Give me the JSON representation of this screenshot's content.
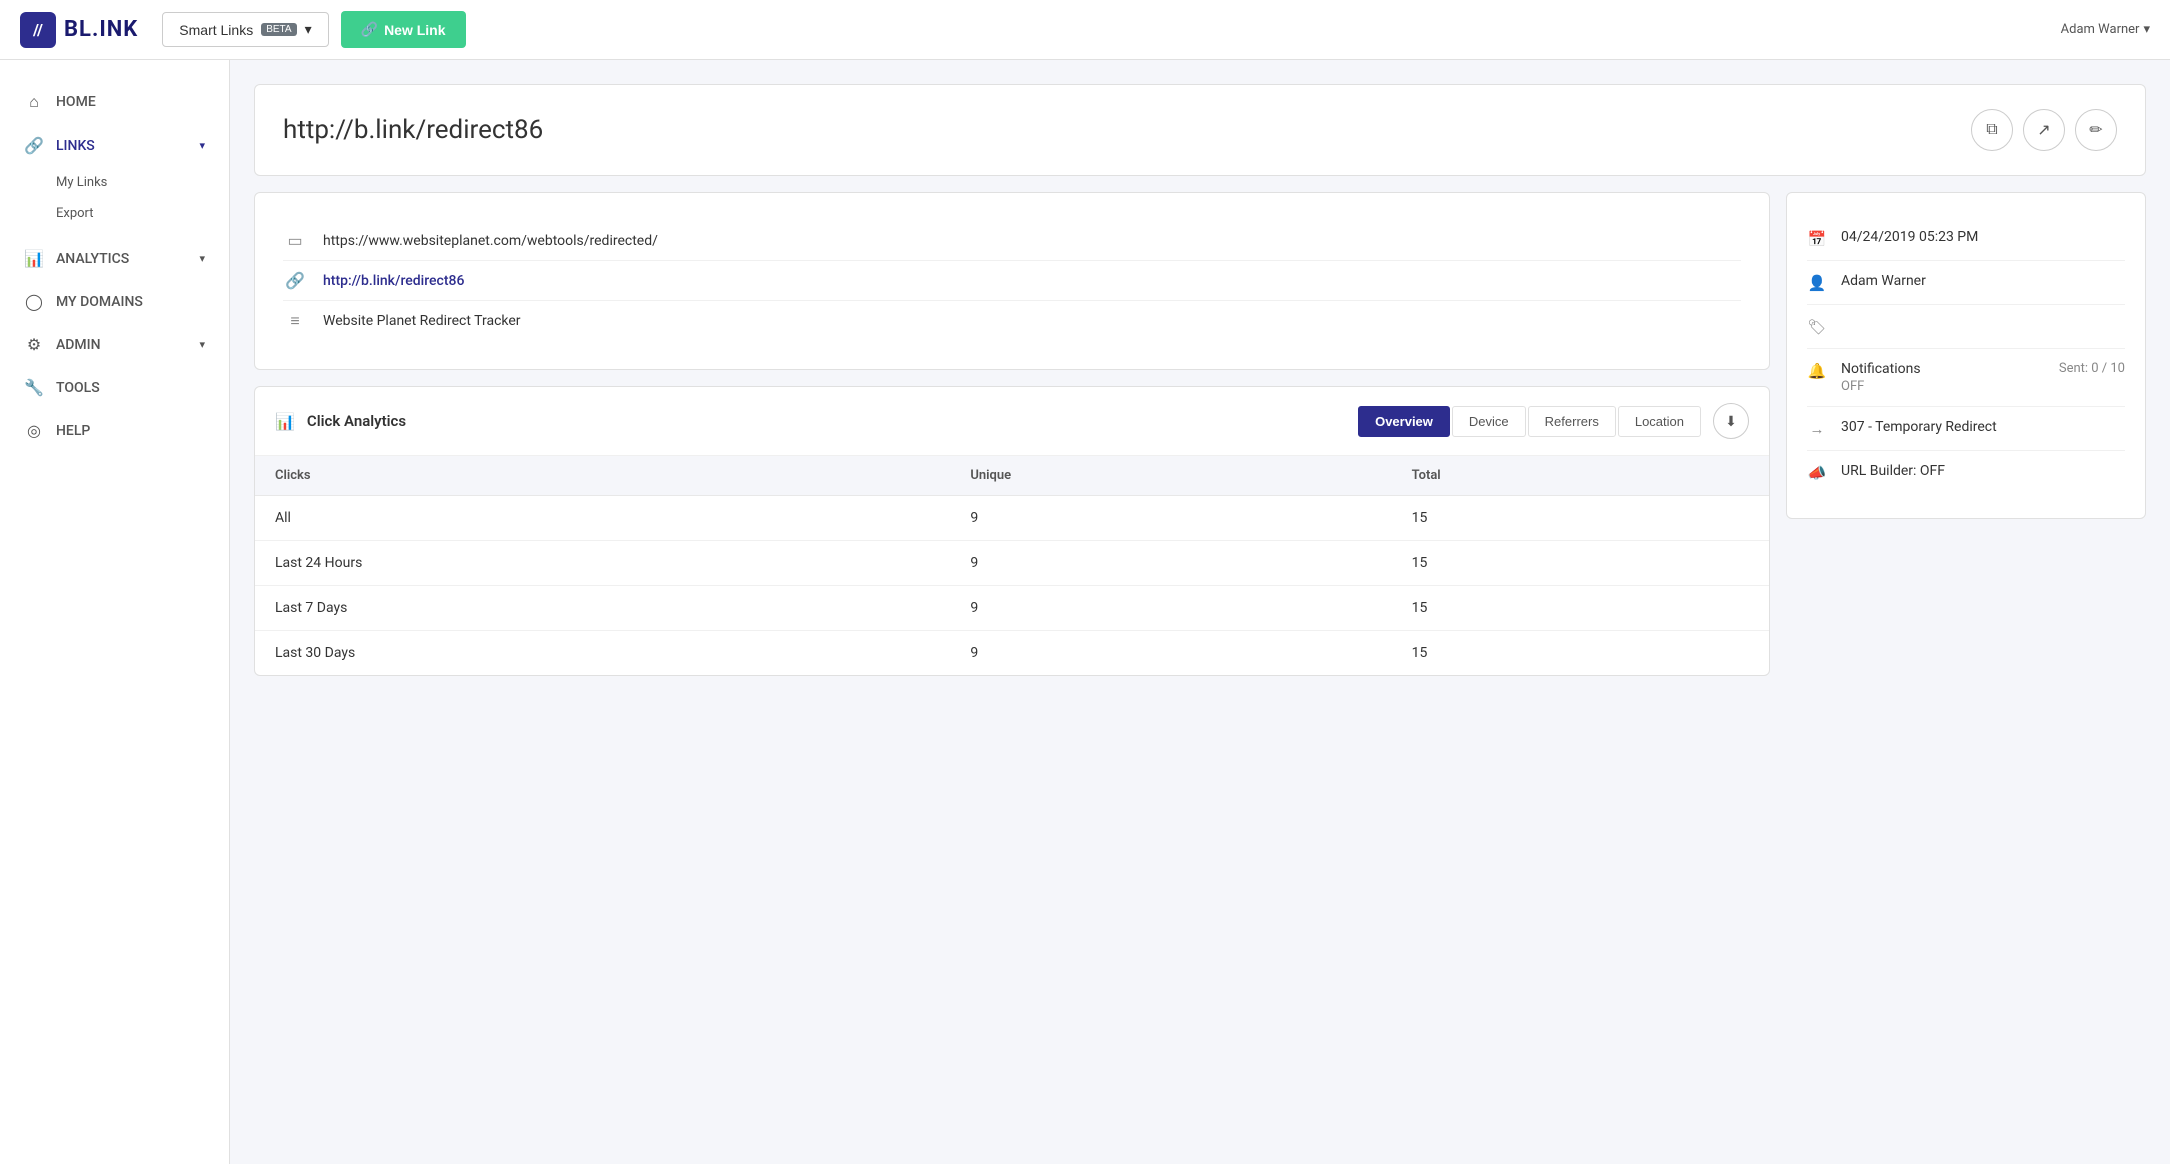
{
  "topnav": {
    "logo_icon": "//",
    "logo_text": "BL.INK",
    "smart_links_label": "Smart Links",
    "beta_label": "BETA",
    "new_link_label": "New Link",
    "user_name": "Adam Warner",
    "chevron": "▾"
  },
  "sidebar": {
    "items": [
      {
        "id": "home",
        "label": "HOME",
        "icon": "⌂",
        "active": false
      },
      {
        "id": "links",
        "label": "LINKS",
        "icon": "🔗",
        "active": true,
        "arrow": "▾"
      },
      {
        "id": "my-links",
        "label": "My Links",
        "sub": true
      },
      {
        "id": "export",
        "label": "Export",
        "sub": true
      },
      {
        "id": "analytics",
        "label": "ANALYTICS",
        "icon": "📊",
        "active": false,
        "arrow": "▾"
      },
      {
        "id": "my-domains",
        "label": "MY DOMAINS",
        "icon": "◯",
        "active": false
      },
      {
        "id": "admin",
        "label": "ADMIN",
        "icon": "⚙",
        "active": false,
        "arrow": "▾"
      },
      {
        "id": "tools",
        "label": "TOOLS",
        "icon": "🔧",
        "active": false
      },
      {
        "id": "help",
        "label": "HELP",
        "icon": "◎",
        "active": false
      }
    ]
  },
  "link_header": {
    "url": "http://b.link/redirect86",
    "actions": [
      {
        "id": "copy",
        "icon": "⧉",
        "label": "Copy"
      },
      {
        "id": "external",
        "icon": "↗",
        "label": "Open external"
      },
      {
        "id": "edit",
        "icon": "✏",
        "label": "Edit"
      }
    ]
  },
  "link_details": {
    "destination_url": "https://www.websiteplanet.com/webtools/redirected/",
    "short_url": "http://b.link/redirect86",
    "title": "Website Planet Redirect Tracker"
  },
  "analytics": {
    "title": "Click Analytics",
    "tabs": [
      {
        "id": "overview",
        "label": "Overview",
        "active": true
      },
      {
        "id": "device",
        "label": "Device",
        "active": false
      },
      {
        "id": "referrers",
        "label": "Referrers",
        "active": false
      },
      {
        "id": "location",
        "label": "Location",
        "active": false
      }
    ],
    "table": {
      "headers": [
        "Clicks",
        "Unique",
        "Total"
      ],
      "rows": [
        {
          "label": "All",
          "unique": 9,
          "total": 15
        },
        {
          "label": "Last 24 Hours",
          "unique": 9,
          "total": 15
        },
        {
          "label": "Last 7 Days",
          "unique": 9,
          "total": 15
        },
        {
          "label": "Last 30 Days",
          "unique": 9,
          "total": 15
        }
      ]
    }
  },
  "info_panel": {
    "created_date": "04/24/2019 05:23 PM",
    "owner": "Adam Warner",
    "tags": "",
    "notifications_label": "Notifications",
    "notifications_status": "OFF",
    "notifications_sent": "Sent: 0 / 10",
    "redirect_type": "307 - Temporary Redirect",
    "url_builder": "URL Builder: OFF"
  }
}
